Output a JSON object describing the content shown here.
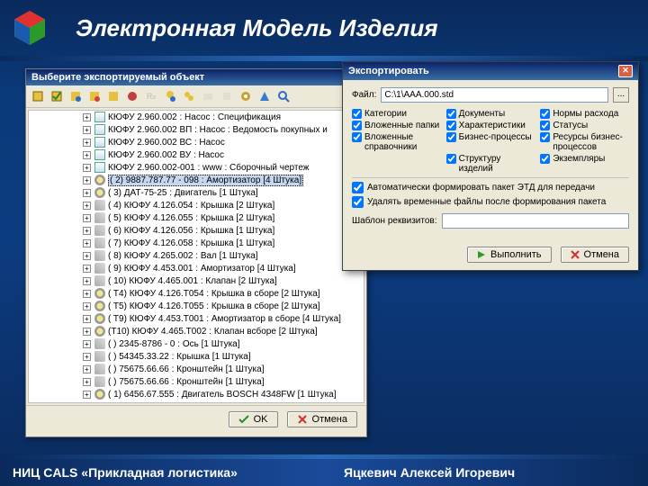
{
  "header": {
    "title": "Электронная Модель Изделия"
  },
  "footer": {
    "left": "НИЦ CALS «Прикладная логистика»",
    "right": "Яцкевич Алексей Игоревич"
  },
  "treewin": {
    "title": "Выберите экспортируемый объект",
    "ok": "OK",
    "cancel": "Отмена",
    "rows": [
      {
        "ind": 60,
        "ic": "doc",
        "t": "КЮФУ 2.960.002 : Насос : Спецификация"
      },
      {
        "ind": 60,
        "ic": "doc",
        "t": "КЮФУ 2.960.002 ВП : Насос : Ведомость покупных и"
      },
      {
        "ind": 60,
        "ic": "doc",
        "t": "КЮФУ 2.960.002 ВС : Насос"
      },
      {
        "ind": 60,
        "ic": "doc",
        "t": "КЮФУ 2.960.002 ВУ : Насос"
      },
      {
        "ind": 60,
        "ic": "doc",
        "t": "КЮФУ 2.960.002-001 : www : Сборочный чертеж"
      },
      {
        "ind": 60,
        "ic": "gear",
        "t": "( 2) 9887.787.77 - 098 : Амортизатор [4 Штука]",
        "sel": true
      },
      {
        "ind": 60,
        "ic": "gear",
        "t": "( 3) ДАТ-75-25 : Двигатель [1 Штука]"
      },
      {
        "ind": 60,
        "ic": "wrench",
        "t": "( 4) КЮФУ 4.126.054 : Крышка [2 Штука]"
      },
      {
        "ind": 60,
        "ic": "wrench",
        "t": "( 5) КЮФУ 4.126.055 : Крышка [2 Штука]"
      },
      {
        "ind": 60,
        "ic": "wrench",
        "t": "( 6) КЮФУ 4.126.056 : Крышка [1 Штука]"
      },
      {
        "ind": 60,
        "ic": "wrench",
        "t": "( 7) КЮФУ 4.126.058 : Крышка [1 Штука]"
      },
      {
        "ind": 60,
        "ic": "wrench",
        "t": "( 8) КЮФУ 4.265.002 : Вал [1 Штука]"
      },
      {
        "ind": 60,
        "ic": "wrench",
        "t": "( 9) КЮФУ 4.453.001 : Амортизатор [4 Штука]"
      },
      {
        "ind": 60,
        "ic": "wrench",
        "t": "( 10) КЮФУ 4.465.001 : Клапан [2 Штука]"
      },
      {
        "ind": 60,
        "ic": "gear",
        "t": "( T4) КЮФУ 4.126.Т054 : Крышка в сборе [2 Штука]"
      },
      {
        "ind": 60,
        "ic": "gear",
        "t": "( T5) КЮФУ 4.126.Т055 : Крышка в сборе [2 Штука]"
      },
      {
        "ind": 60,
        "ic": "gear",
        "t": "( T9) КЮФУ 4.453.Т001 : Амортизатор в сборе [4 Штука]"
      },
      {
        "ind": 60,
        "ic": "gear",
        "t": "(T10) КЮФУ 4.465.Т002 : Клапан всборе [2 Штука]"
      },
      {
        "ind": 60,
        "ic": "wrench",
        "t": "(  ) 2345-8786 - 0 : Ось [1 Штука]"
      },
      {
        "ind": 60,
        "ic": "wrench",
        "t": "(  ) 54345.33.22 : Крышка [1 Штука]"
      },
      {
        "ind": 60,
        "ic": "wrench",
        "t": "(  ) 75675.66.66 : Кронштейн [1 Штука]"
      },
      {
        "ind": 60,
        "ic": "wrench",
        "t": "(  ) 75675.66.66 : Кронштейн [1 Штука]"
      },
      {
        "ind": 60,
        "ic": "gear",
        "t": "( 1) 6456.67.555 : Двигатель BOSCH 4348FW [1 Штука]"
      }
    ]
  },
  "dialog": {
    "title": "Экспортировать",
    "file_label": "Файл:",
    "file_value": "C:\\1\\AAA.000.std",
    "checks": [
      [
        "Категории",
        "Документы",
        "Нормы расхода"
      ],
      [
        "Вложенные папки",
        "Характеристики",
        "Статусы"
      ],
      [
        "Вложенные справочники",
        "Бизнес-процессы",
        "Ресурсы бизнес-процессов"
      ],
      [
        "",
        "Структуру изделий",
        "Экземпляры"
      ]
    ],
    "auto": "Автоматически формировать пакет ЭТД для передачи",
    "del": "Удалять временные файлы после формирования пакета",
    "template_label": "Шаблон реквизитов:",
    "run": "Выполнить",
    "cancel": "Отмена"
  }
}
